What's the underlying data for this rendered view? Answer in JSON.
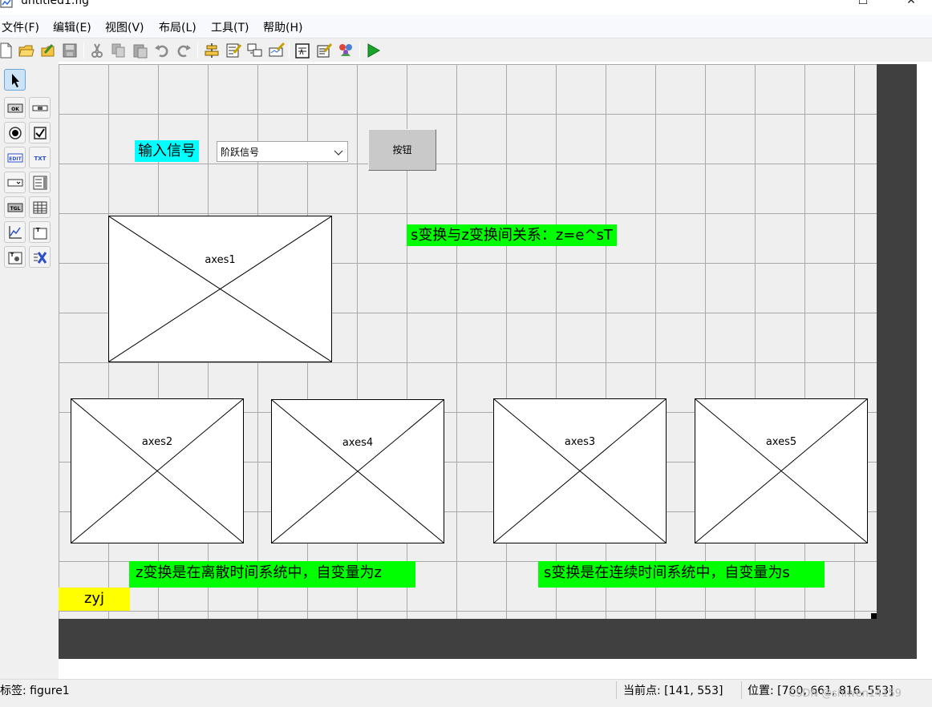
{
  "window": {
    "title": "untitled1.fig",
    "maximize_glyph": "☐",
    "close_glyph": "✕"
  },
  "menu": [
    "文件(F)",
    "编辑(E)",
    "视图(V)",
    "布局(L)",
    "工具(T)",
    "帮助(H)"
  ],
  "toolbar_icons": [
    "new-icon",
    "open-icon",
    "save-as-icon",
    "save-icon",
    "cut-icon",
    "copy-icon",
    "paste-icon",
    "undo-icon",
    "redo-icon",
    "align-icon",
    "menu-editor-icon",
    "tab-order-icon",
    "toolbar-editor-icon",
    "editor-icon",
    "property-inspector-icon",
    "object-browser-icon",
    "run-icon"
  ],
  "palette_icons": [
    "select-icon",
    "pushbutton-icon",
    "slider-icon",
    "radiobutton-icon",
    "checkbox-icon",
    "edit-text-icon",
    "static-text-icon",
    "popup-menu-icon",
    "listbox-icon",
    "toggle-button-icon",
    "table-icon",
    "axes-icon",
    "panel-icon",
    "button-group-icon",
    "activex-icon"
  ],
  "canvas": {
    "input_label": "输入信号",
    "popup_value": "阶跃信号",
    "button_label": "按钮",
    "relation_text": "s变换与z变换间关系：z=e^sT",
    "z_note": "z变换是在离散时间系统中，自变量为z",
    "s_note": "s变换是在连续时间系统中，自变量为s",
    "author": "zyj",
    "axes": [
      "axes1",
      "axes2",
      "axes4",
      "axes3",
      "axes5"
    ]
  },
  "status": {
    "tag": "标签: figure1",
    "current_point": "当前点:  [141, 553]",
    "position": "位置: [760, 661, 816, 553]",
    "watermark": "CSDN @shiwen14159"
  },
  "colors": {
    "cyan_label": "#00ffff",
    "green_label": "#00ff00",
    "yellow_label": "#ffff00",
    "run_green": "#1aa32a",
    "canvas_dark": "#404040"
  }
}
